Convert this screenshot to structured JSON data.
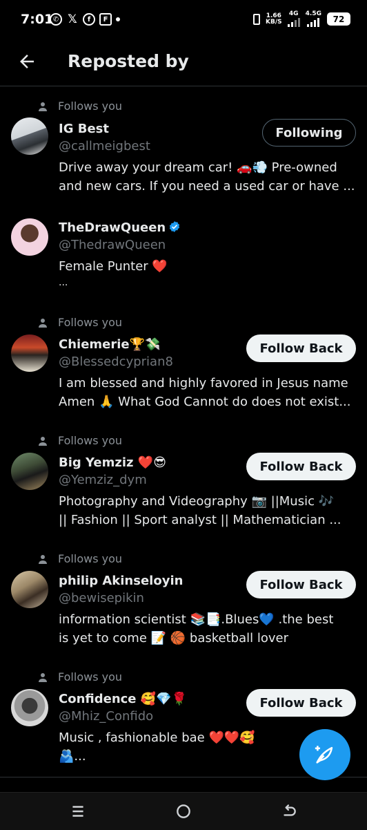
{
  "status_bar": {
    "time": "7:01",
    "net_speed_value": "1.66",
    "net_speed_unit": "KB/S",
    "net1": "4G",
    "net2": "4.5G",
    "battery": "72"
  },
  "header": {
    "title": "Reposted by"
  },
  "follows_label": "Follows you",
  "users": [
    {
      "name": "IG Best",
      "name_emoji": "",
      "handle": "@callmeigbest",
      "bio_line1": "Drive away your dream car! 🚗💨 Pre-owned",
      "bio_line2": "and new cars. If you need a used car or have ...",
      "button": "Following",
      "follows_you": true
    },
    {
      "name": "TheDrawQueen",
      "name_emoji": "",
      "handle": "@ThedrawQueen",
      "bio_line1": "Female Punter ❤️",
      "bio_line2": "...",
      "button": "",
      "follows_you": false
    },
    {
      "name": "Chiemerie",
      "name_emoji": "🏆💸",
      "handle": "@Blessedcyprian8",
      "bio_line1": "I am blessed and highly favored in Jesus name",
      "bio_line2": "Amen 🙏 What God Cannot do does not exist...",
      "button": "Follow Back",
      "follows_you": true
    },
    {
      "name": "Big Yemziz",
      "name_emoji": "❤️😎",
      "handle": "@Yemziz_dym",
      "bio_line1": "Photography and Videography 📷 ||Music 🎶",
      "bio_line2": "|| Fashion  || Sport analyst ||  Mathematician ...",
      "button": "Follow Back",
      "follows_you": true
    },
    {
      "name": "philip Akinseloyin",
      "name_emoji": "",
      "handle": "@bewisepikin",
      "bio_line1": "information scientist 📚📑.Blues💙 .the best",
      "bio_line2": "is yet to come 📝 🏀 basketball lover",
      "button": "Follow Back",
      "follows_you": true
    },
    {
      "name": "Confidence",
      "name_emoji": "🥰💎🌹",
      "handle": "@Mhiz_Confido",
      "bio_line1": "Music , fashionable bae ❤️❤️🥰",
      "bio_line2": "🫂...",
      "button": "Follow Back",
      "follows_you": true
    }
  ],
  "colors": {
    "accent": "#1d9bf0",
    "verified": "#1d9bf0",
    "background": "#000000"
  },
  "fab_icon": "compose-feather-icon"
}
